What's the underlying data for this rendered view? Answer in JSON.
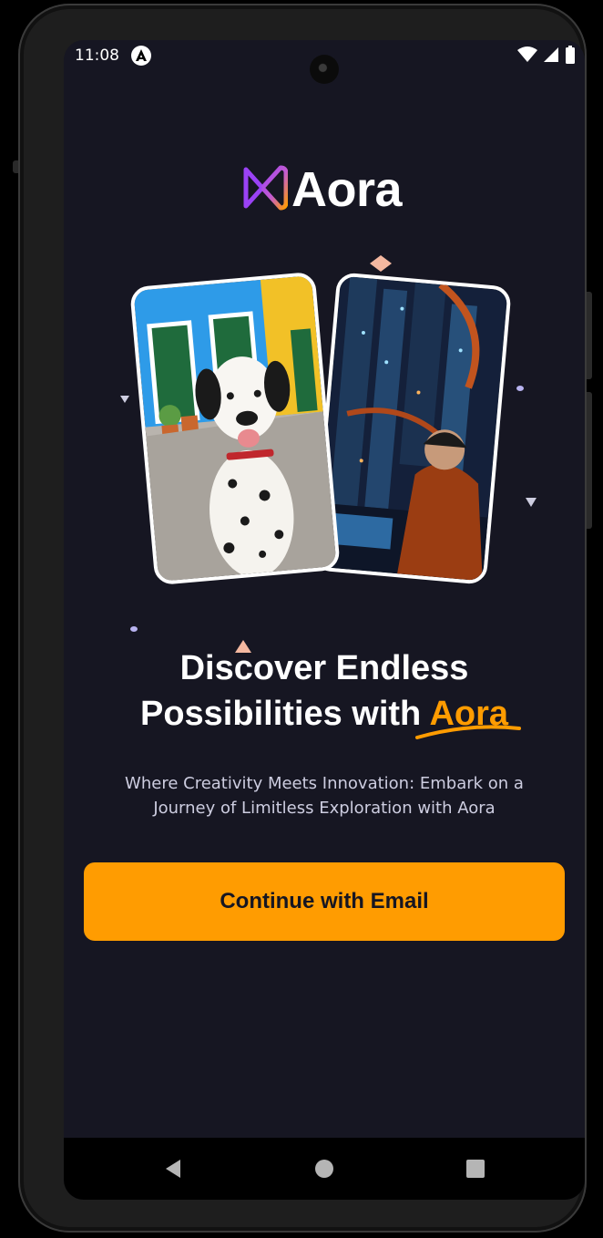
{
  "status_bar": {
    "time": "11:08",
    "icons": [
      "react-native-icon",
      "wifi-icon",
      "signal-icon",
      "battery-icon"
    ]
  },
  "app": {
    "name": "Aora",
    "brand_color": "#FF9C01",
    "logo_gradient": [
      "#9A42F5",
      "#FF9C01"
    ]
  },
  "hero": {
    "images": [
      "dalmatian-dog-image",
      "futuristic-city-hacker-image"
    ],
    "headline_line1": "Discover Endless",
    "headline_line2": "Possibilities with",
    "headline_accent": "Aora",
    "subtext": "Where Creativity Meets Innovation: Embark on a Journey of Limitless Exploration with Aora"
  },
  "cta": {
    "label": "Continue with Email"
  },
  "nav": {
    "icons": [
      "back-icon",
      "home-icon",
      "recents-icon"
    ]
  },
  "colors": {
    "background": "#161622",
    "text_secondary": "#CDCDE0"
  }
}
